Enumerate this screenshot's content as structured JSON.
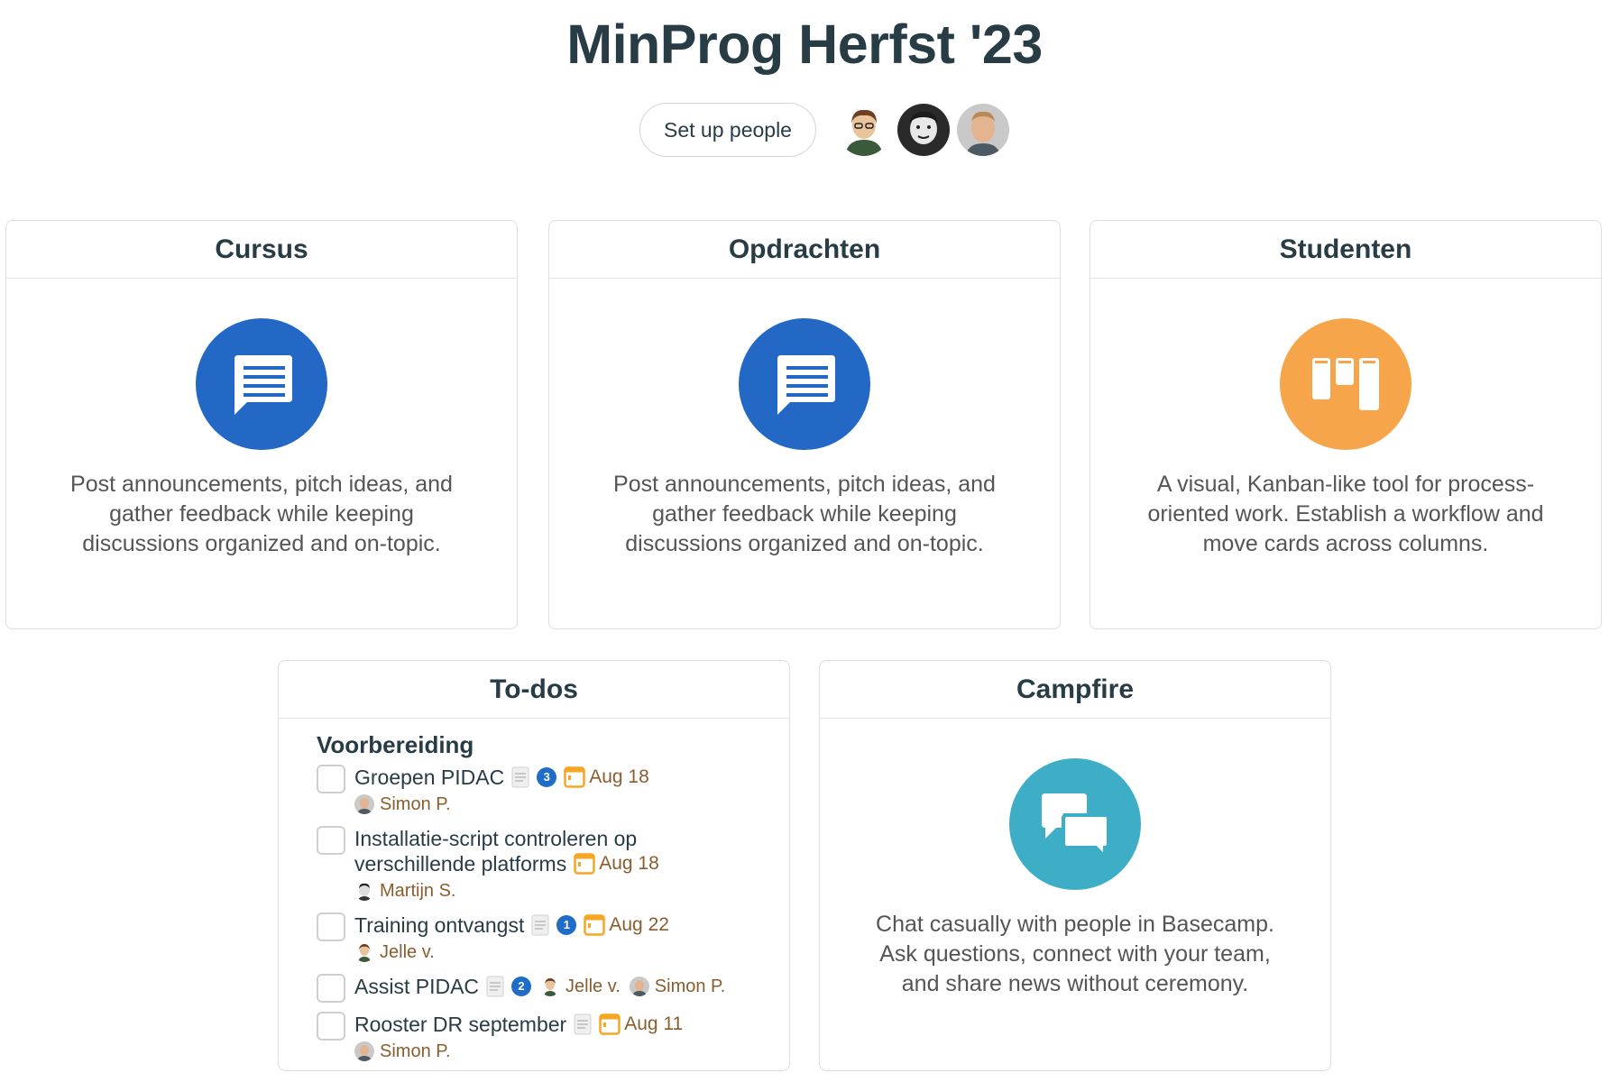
{
  "project": {
    "title": "MinProg Herfst '23",
    "setup_people_label": "Set up people"
  },
  "people": [
    "avatar-person-1",
    "avatar-person-2",
    "avatar-person-3"
  ],
  "colors": {
    "message_board_blue": "#2368c4",
    "kanban_orange": "#f6a54b",
    "campfire_teal": "#3eaec6",
    "due_brown": "#8a5d2e",
    "badge_blue": "#1f6dc9"
  },
  "cards": {
    "cursus": {
      "title": "Cursus",
      "icon": "message-board-icon",
      "description": "Post announcements, pitch ideas, and gather feedback while keeping discussions organized and on-topic."
    },
    "opdrachten": {
      "title": "Opdrachten",
      "icon": "message-board-icon",
      "description": "Post announcements, pitch ideas, and gather feedback while keeping discussions organized and on-topic."
    },
    "studenten": {
      "title": "Studenten",
      "icon": "card-table-icon",
      "description": "A visual, Kanban-like tool for process-oriented work. Establish a workflow and move cards across columns."
    },
    "todos": {
      "title": "To-dos",
      "group_title": "Voorbereiding",
      "items": [
        {
          "title": "Groepen PIDAC",
          "comments": "3",
          "due": "Aug 18",
          "assignee": "Simon P."
        },
        {
          "title_line1": "Installatie-script controleren op",
          "title_line2": "verschillende platforms",
          "due": "Aug 18",
          "assignee": "Martijn S."
        },
        {
          "title": "Training ontvangst",
          "comments": "1",
          "due": "Aug 22",
          "assignee": "Jelle v."
        },
        {
          "title": "Assist PIDAC",
          "comments": "2",
          "assignee_1": "Jelle v.",
          "assignee_2": "Simon P."
        },
        {
          "title": "Rooster DR september",
          "due": "Aug 11",
          "assignee": "Simon P."
        }
      ]
    },
    "campfire": {
      "title": "Campfire",
      "icon": "chat-bubbles-icon",
      "description": "Chat casually with people in Basecamp. Ask questions, connect with your team, and share news without ceremony."
    }
  }
}
